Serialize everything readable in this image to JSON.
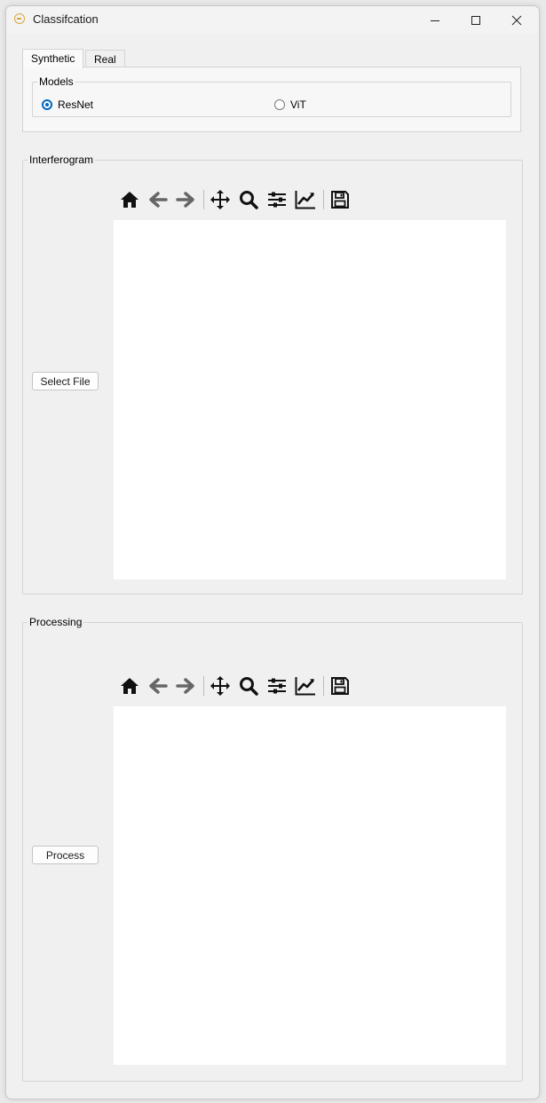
{
  "window": {
    "title": "Classifcation"
  },
  "tabs": [
    {
      "label": "Synthetic",
      "active": true
    },
    {
      "label": "Real",
      "active": false
    }
  ],
  "models_group": {
    "title": "Models",
    "options": [
      {
        "label": "ResNet",
        "checked": true
      },
      {
        "label": "ViT",
        "checked": false
      }
    ]
  },
  "interferogram": {
    "title": "Interferogram",
    "button_label": "Select File"
  },
  "processing": {
    "title": "Processing",
    "button_label": "Process"
  },
  "toolbar_icons": [
    "home-icon",
    "back-arrow-icon",
    "forward-arrow-icon",
    "pan-icon",
    "zoom-icon",
    "configure-subplots-icon",
    "edit-axis-icon",
    "save-icon"
  ],
  "colors": {
    "accent": "#0067c0",
    "window_bg": "#f0f0f0",
    "canvas_bg": "#ffffff"
  }
}
